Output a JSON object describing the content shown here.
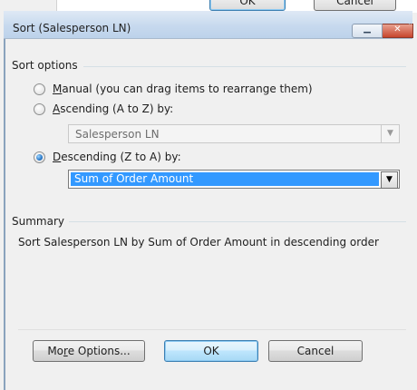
{
  "behind": {
    "ok_label": "OK",
    "cancel_label": "Cancel"
  },
  "dialog": {
    "title": "Sort (Salesperson LN)",
    "window_controls": {
      "minimize": "minimize-icon",
      "close": "close-icon"
    }
  },
  "sort_options": {
    "group_label": "Sort options",
    "manual": {
      "label_prefix": "",
      "label_underlined": "M",
      "label_rest": "anual (you can drag items to rearrange them)",
      "checked": false
    },
    "ascending": {
      "label_underlined": "A",
      "label_rest": "scending (A to Z) by:",
      "checked": false
    },
    "ascending_combo_value": "Salesperson LN",
    "descending": {
      "label_underlined": "D",
      "label_rest": "escending (Z to A) by:",
      "checked": true
    },
    "descending_combo_value": "Sum of Order Amount"
  },
  "summary": {
    "group_label": "Summary",
    "text": "Sort Salesperson LN by Sum of Order Amount in descending order"
  },
  "buttons": {
    "more_options": {
      "before": "Mo",
      "underlined": "r",
      "after": "e Options..."
    },
    "ok": "OK",
    "cancel": "Cancel"
  },
  "colors": {
    "selection": "#3399ff",
    "default_button_border": "#3c7fb1",
    "title_bar": "#c7d9ee",
    "close_button": "#c7452d"
  }
}
